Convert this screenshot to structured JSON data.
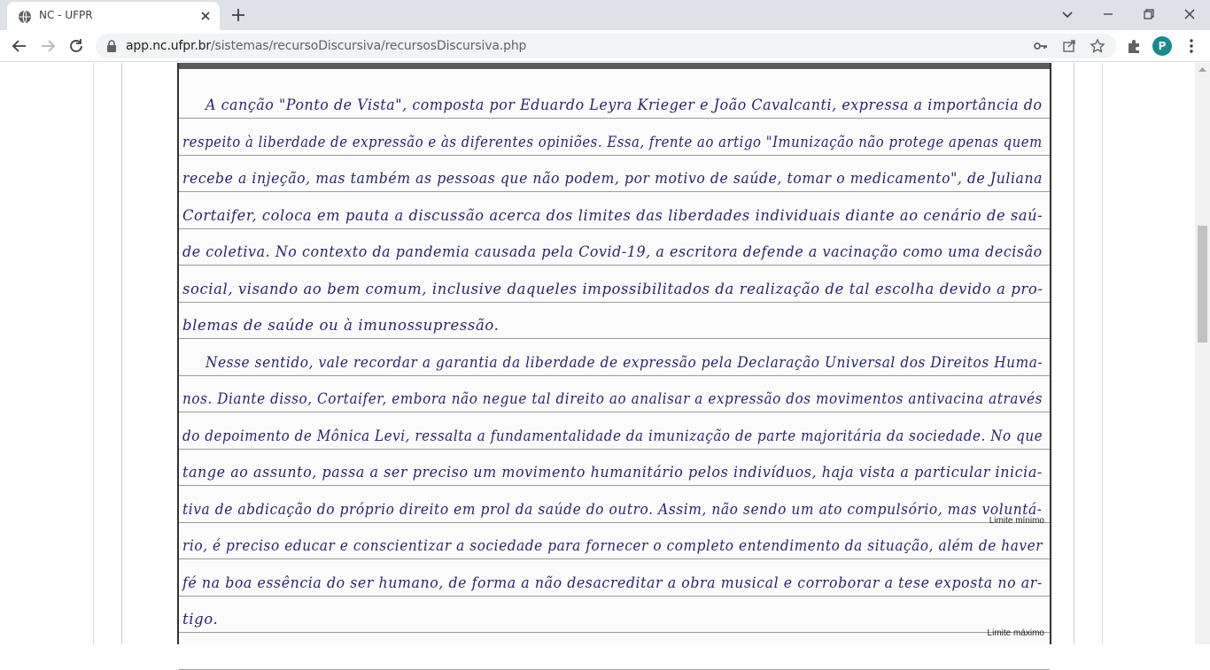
{
  "browser": {
    "tab": {
      "title": "NC - UFPR",
      "favicon": "globe-icon",
      "close_icon": "close-icon"
    },
    "new_tab_icon": "plus-icon",
    "window_controls": [
      "chevron-down-icon",
      "minimize-icon",
      "restore-icon",
      "close-icon"
    ],
    "nav": [
      "back-arrow-icon",
      "forward-arrow-icon",
      "reload-icon"
    ],
    "address": {
      "host": "app.nc.ufpr.br",
      "path": "/sistemas/recursoDiscursiva/recursosDiscursiva.php"
    },
    "omnibox_icons": [
      "key-icon",
      "share-icon",
      "star-icon"
    ],
    "extensions_icon": "puzzle-icon",
    "profile_initial": "P",
    "menu_icon": "kebab-menu-icon",
    "accent_color": "#188a8d"
  },
  "answer_sheet": {
    "lines": [
      "A canção \"Ponto de Vista\", composta por Eduardo Leyra Krieger e João Cavalcanti, expressa a importância do",
      "respeito à liberdade de expressão e às diferentes opiniões. Essa, frente ao artigo \"Imunização não protege apenas quem",
      "recebe a injeção, mas também as pessoas que não podem, por motivo de saúde, tomar o medicamento\", de Juliana",
      "Cortaifer, coloca em pauta a discussão acerca dos limites das liberdades individuais diante ao cenário de saú-",
      "de coletiva. No contexto da pandemia causada pela Covid-19, a escritora defende a vacinação como uma decisão",
      "social, visando ao bem comum, inclusive daqueles impossibilitados da realização de tal escolha devido a pro-",
      "blemas de saúde ou à imunossupressão.",
      "Nesse sentido, vale recordar a garantia da liberdade de expressão pela Declaração Universal dos Direitos Huma-",
      "nos. Diante disso, Cortaifer, embora não negue tal direito ao analisar a expressão dos movimentos antivacina através",
      "do depoimento de Mônica Levi, ressalta a fundamentalidade da imunização de parte majoritária da sociedade. No que",
      "tange ao assunto, passa a ser preciso um movimento humanitário pelos indivíduos, haja vista a particular inicia-",
      "tiva de abdicação do próprio direito em prol da saúde do outro. Assim, não sendo um ato compulsório, mas voluntá-",
      "rio, é preciso educar e conscientizar a sociedade para fornecer o completo entendimento da situação, além de haver",
      "fé na boa essência do ser humano, de forma a não desacreditar a obra musical e corroborar a tese exposta no ar-",
      "tigo."
    ],
    "limit_min_label": "Limite mínimo",
    "limit_max_label": "Limite máximo",
    "ink_color": "#28266e"
  }
}
